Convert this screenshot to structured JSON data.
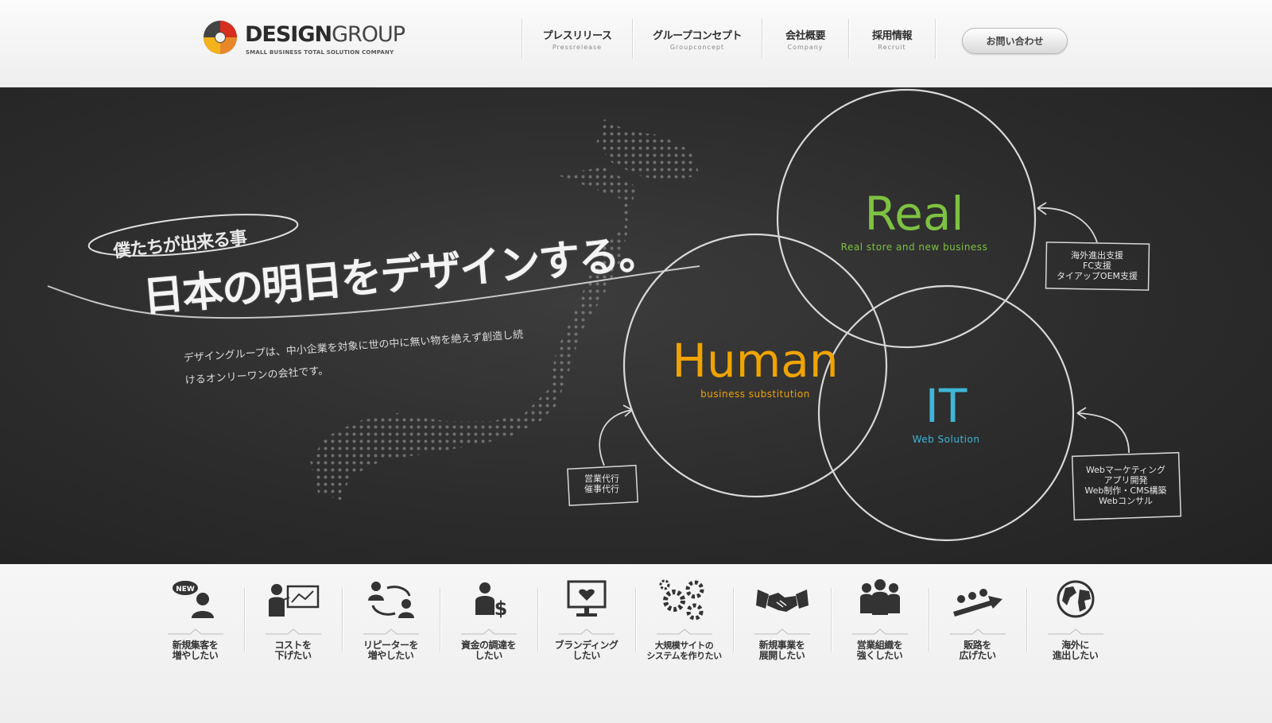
{
  "header": {
    "logo": {
      "brand_bold": "DESIGN",
      "brand_light": "GROUP",
      "tagline": "SMALL BUSINESS TOTAL SOLUTION COMPANY"
    },
    "nav": [
      {
        "jp": "プレスリリース",
        "en": "Pressrelease"
      },
      {
        "jp": "グループコンセプト",
        "en": "Groupconcept"
      },
      {
        "jp": "会社概要",
        "en": "Company"
      },
      {
        "jp": "採用情報",
        "en": "Recruit"
      }
    ],
    "contact_label": "お問い合わせ"
  },
  "hero": {
    "catch": "僕たちが出来る事",
    "headline": "日本の明日をデザインする。",
    "description": "デザイングループは、中小企業を対象に世の中に無い物を絶えず創造し続けるオンリーワンの会社です。",
    "circles": {
      "real": {
        "title": "Real",
        "subtitle": "Real store and new business",
        "color": "#7dc242"
      },
      "human": {
        "title": "Human",
        "subtitle": "business substitution",
        "color": "#f0a400"
      },
      "it": {
        "title": "IT",
        "subtitle": "Web Solution",
        "color": "#3fb6d8"
      }
    },
    "notes": {
      "real": [
        "海外進出支援",
        "FC支援",
        "タイアップOEM支援"
      ],
      "human": [
        "営業代行",
        "催事代行"
      ],
      "it": [
        "Webマーケティング",
        "アプリ開発",
        "Web制作・CMS構築",
        "Webコンサル"
      ]
    }
  },
  "services": [
    {
      "label": "新規集客を\n増やしたい",
      "icon": "new-customer-icon",
      "badge": "NEW"
    },
    {
      "label": "コストを\n下げたい",
      "icon": "presentation-icon"
    },
    {
      "label": "リピーターを\n増やしたい",
      "icon": "repeat-users-icon"
    },
    {
      "label": "資金の調達を\nしたい",
      "icon": "funding-icon"
    },
    {
      "label": "ブランディング\nしたい",
      "icon": "monitor-heart-icon"
    },
    {
      "label": "大規模サイトの\nシステムを作りたい",
      "icon": "gears-icon"
    },
    {
      "label": "新規事業を\n展開したい",
      "icon": "handshake-icon"
    },
    {
      "label": "営業組織を\n強くしたい",
      "icon": "team-icon"
    },
    {
      "label": "販路を\n広げたい",
      "icon": "growth-icon"
    },
    {
      "label": "海外に\n進出したい",
      "icon": "globe-icon"
    }
  ]
}
